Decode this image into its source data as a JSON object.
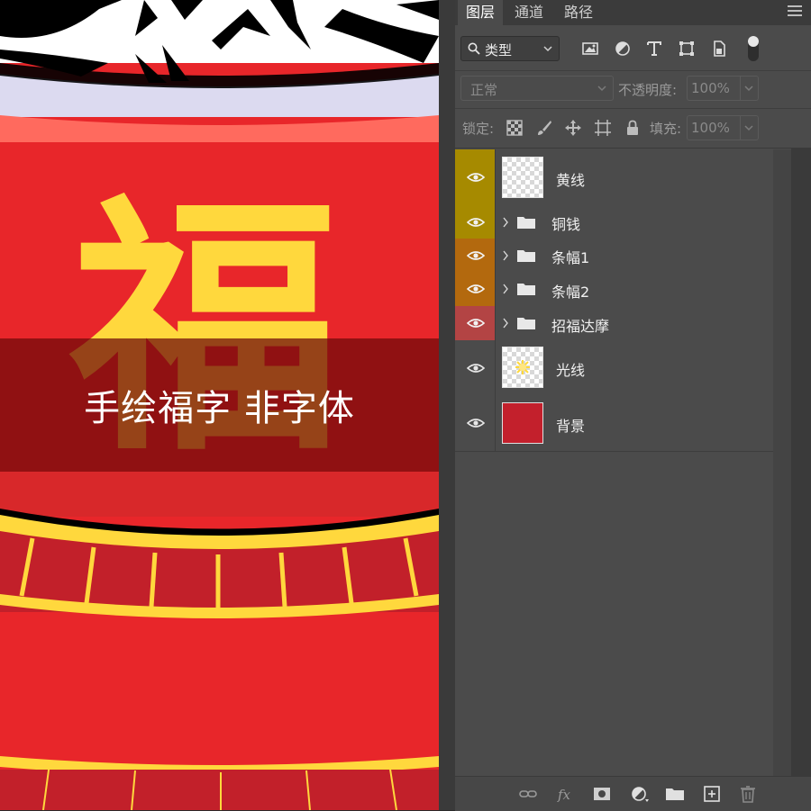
{
  "canvas": {
    "caption": "手绘福字  非字体",
    "fu_char": "福",
    "colors": {
      "background": "#e8262a",
      "band": "#c8202a",
      "gold": "#ffd83d",
      "rim": "#ff6a5e"
    }
  },
  "panel": {
    "tabs": [
      {
        "label": "图层",
        "active": true
      },
      {
        "label": "通道",
        "active": false
      },
      {
        "label": "路径",
        "active": false
      }
    ],
    "filter": {
      "kind_label": "类型"
    },
    "blend": {
      "mode": "正常",
      "opacity_label": "不透明度:",
      "opacity_value": "100%"
    },
    "lock": {
      "label": "锁定:",
      "fill_label": "填充:",
      "fill_value": "100%"
    },
    "layers": [
      {
        "name": "黄线",
        "type": "pixel",
        "label_color": "#a68a00",
        "thumb": "transparent"
      },
      {
        "name": "铜钱",
        "type": "group",
        "label_color": "#a68a00"
      },
      {
        "name": "条幅1",
        "type": "group",
        "label_color": "#b3690e"
      },
      {
        "name": "条幅2",
        "type": "group",
        "label_color": "#b3690e"
      },
      {
        "name": "招福达摩",
        "type": "group",
        "label_color": "#b34444"
      },
      {
        "name": "光线",
        "type": "pixel",
        "label_color": "none",
        "thumb": "sunburst"
      },
      {
        "name": "背景",
        "type": "pixel",
        "label_color": "none",
        "thumb": "red"
      }
    ]
  }
}
